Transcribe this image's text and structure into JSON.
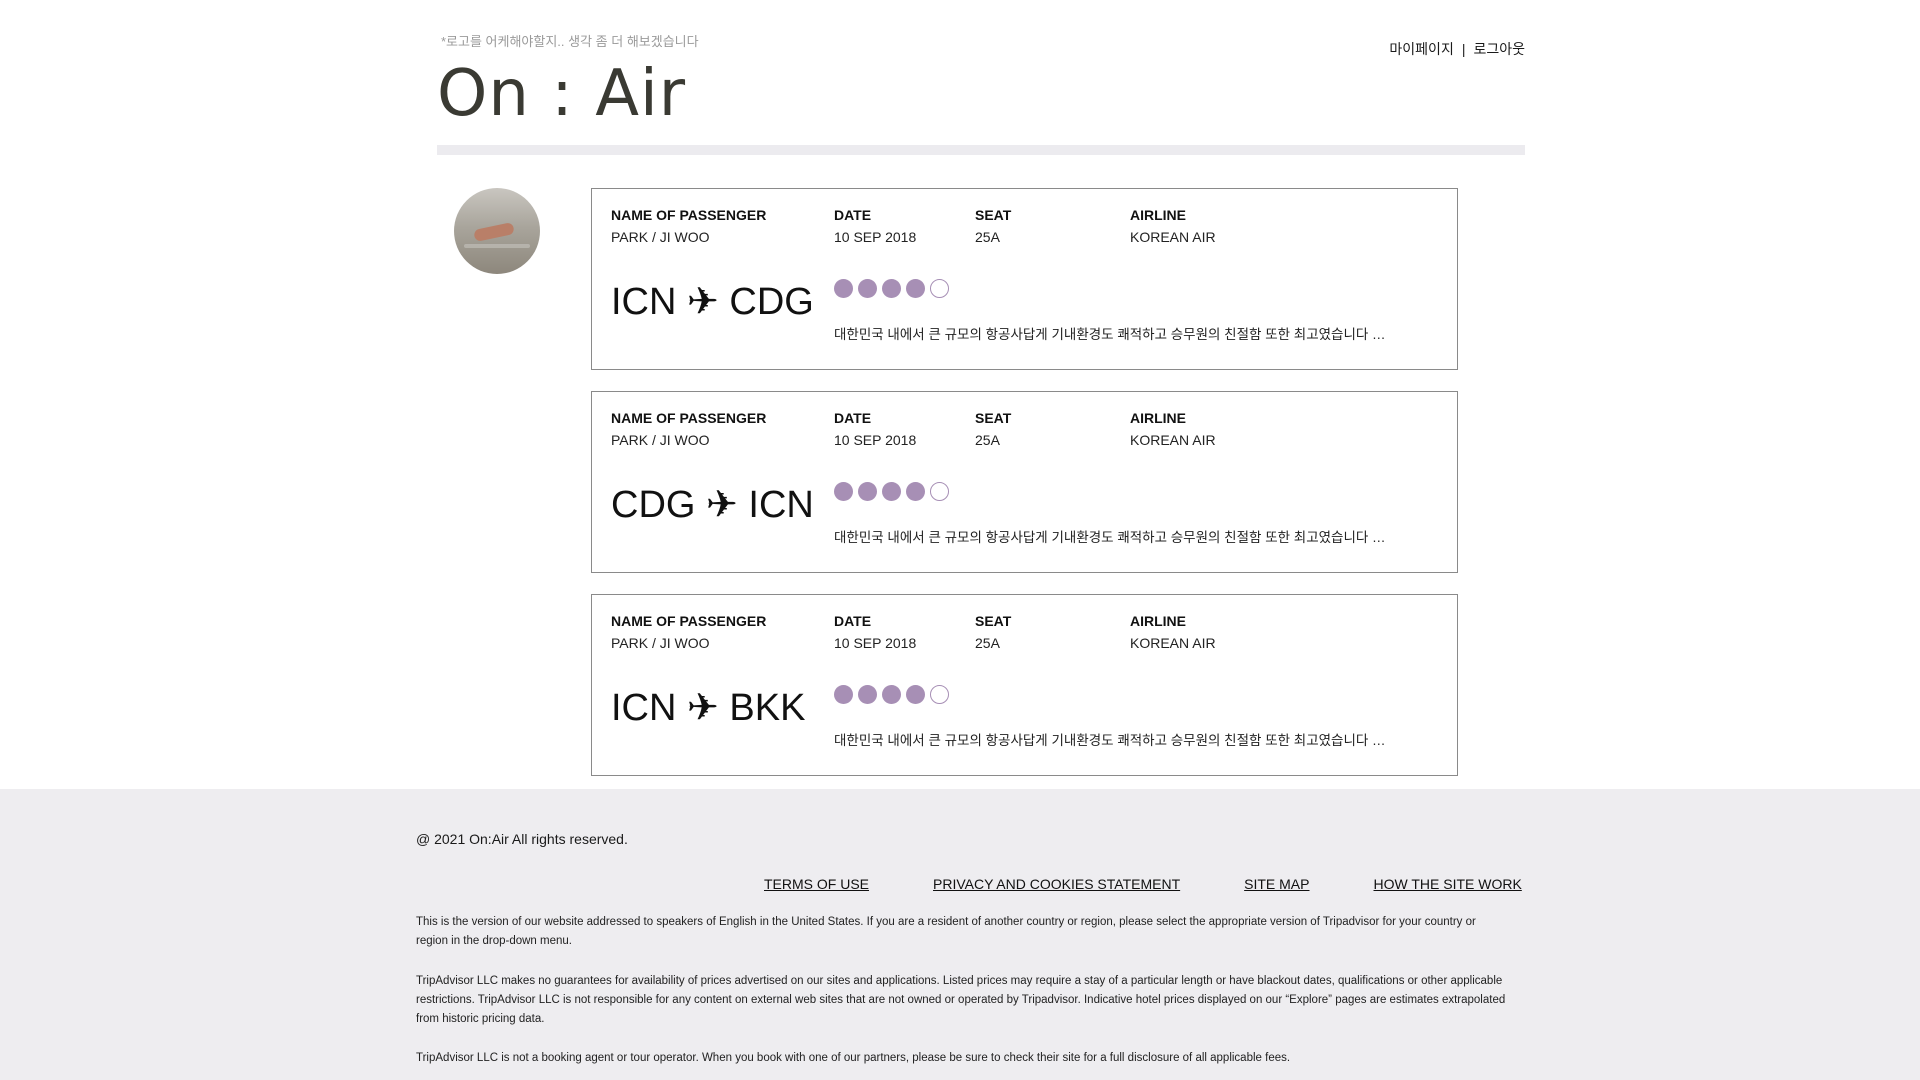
{
  "header": {
    "note": "*로고를 어케해야할지.. 생각 좀 더 해보겠습니다",
    "logo": "On : Air",
    "nav": {
      "mypage": "마이페이지",
      "separator": "|",
      "logout": "로그아웃"
    }
  },
  "tickets": [
    {
      "name_label": "NAME OF PASSENGER",
      "name": "PARK / JI WOO",
      "date_label": "DATE",
      "date": "10 SEP 2018",
      "seat_label": "SEAT",
      "seat": "25A",
      "airline_label": "AIRLINE",
      "airline": "KOREAN AIR",
      "route": "ICN ✈ CDG",
      "rating": 4,
      "rating_max": 5,
      "review": "대한민국 내에서 큰 규모의 항공사답게 기내환경도 쾌적하고 승무원의 친절함 또한 최고였습니다 …"
    },
    {
      "name_label": "NAME OF PASSENGER",
      "name": "PARK / JI WOO",
      "date_label": "DATE",
      "date": "10 SEP 2018",
      "seat_label": "SEAT",
      "seat": "25A",
      "airline_label": "AIRLINE",
      "airline": "KOREAN AIR",
      "route": "CDG ✈ ICN",
      "rating": 4,
      "rating_max": 5,
      "review": "대한민국 내에서 큰 규모의 항공사답게 기내환경도 쾌적하고 승무원의 친절함 또한 최고였습니다 …"
    },
    {
      "name_label": "NAME OF PASSENGER",
      "name": "PARK / JI WOO",
      "date_label": "DATE",
      "date": "10 SEP 2018",
      "seat_label": "SEAT",
      "seat": "25A",
      "airline_label": "AIRLINE",
      "airline": "KOREAN AIR",
      "route": "ICN ✈ BKK",
      "rating": 4,
      "rating_max": 5,
      "review": "대한민국 내에서 큰 규모의 항공사답게 기내환경도 쾌적하고 승무원의 친절함 또한 최고였습니다 …"
    }
  ],
  "footer": {
    "copyright": "@ 2021 On:Air All rights reserved.",
    "links": [
      "TERMS OF USE",
      "PRIVACY AND COOKIES STATEMENT",
      "SITE MAP",
      "HOW THE SITE WORK"
    ],
    "paragraphs": [
      "This is the version of our website addressed to speakers of English in the United States. If you are a resident of another country or region, please select the appropriate version of Tripadvisor for your country or region in the drop-down menu.",
      "TripAdvisor LLC makes no guarantees for availability of prices advertised on our sites and applications. Listed prices may require a stay of a particular length or have blackout dates, qualifications or other applicable restrictions. TripAdvisor LLC is not responsible for any content on external web sites that are not owned or operated by Tripadvisor. Indicative hotel prices displayed on our “Explore” pages are estimates extrapolated from historic pricing data.",
      "TripAdvisor LLC is not a booking agent or tour operator. When you book with one of our partners, please be sure to check their site for a full disclosure of all applicable fees."
    ]
  },
  "colors": {
    "accent": "#a78fb5",
    "footer_bg": "#eeedf0",
    "logo": "#3a3a33"
  },
  "icons": {
    "avatar": "profile-photo",
    "plane": "airplane-icon"
  }
}
